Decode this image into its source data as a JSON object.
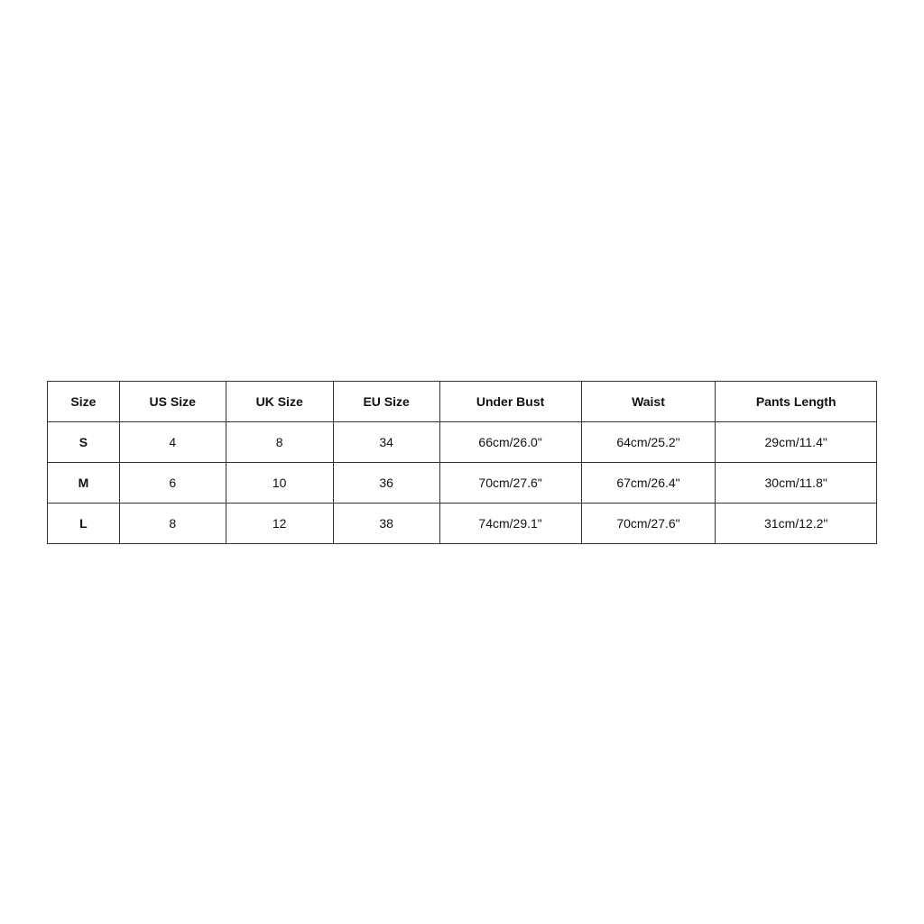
{
  "table": {
    "headers": [
      "Size",
      "US Size",
      "UK Size",
      "EU Size",
      "Under Bust",
      "Waist",
      "Pants Length"
    ],
    "rows": [
      {
        "size": "S",
        "us_size": "4",
        "uk_size": "8",
        "eu_size": "34",
        "under_bust": "66cm/26.0\"",
        "waist": "64cm/25.2\"",
        "pants_length": "29cm/11.4\""
      },
      {
        "size": "M",
        "us_size": "6",
        "uk_size": "10",
        "eu_size": "36",
        "under_bust": "70cm/27.6\"",
        "waist": "67cm/26.4\"",
        "pants_length": "30cm/11.8\""
      },
      {
        "size": "L",
        "us_size": "8",
        "uk_size": "12",
        "eu_size": "38",
        "under_bust": "74cm/29.1\"",
        "waist": "70cm/27.6\"",
        "pants_length": "31cm/12.2\""
      }
    ]
  }
}
